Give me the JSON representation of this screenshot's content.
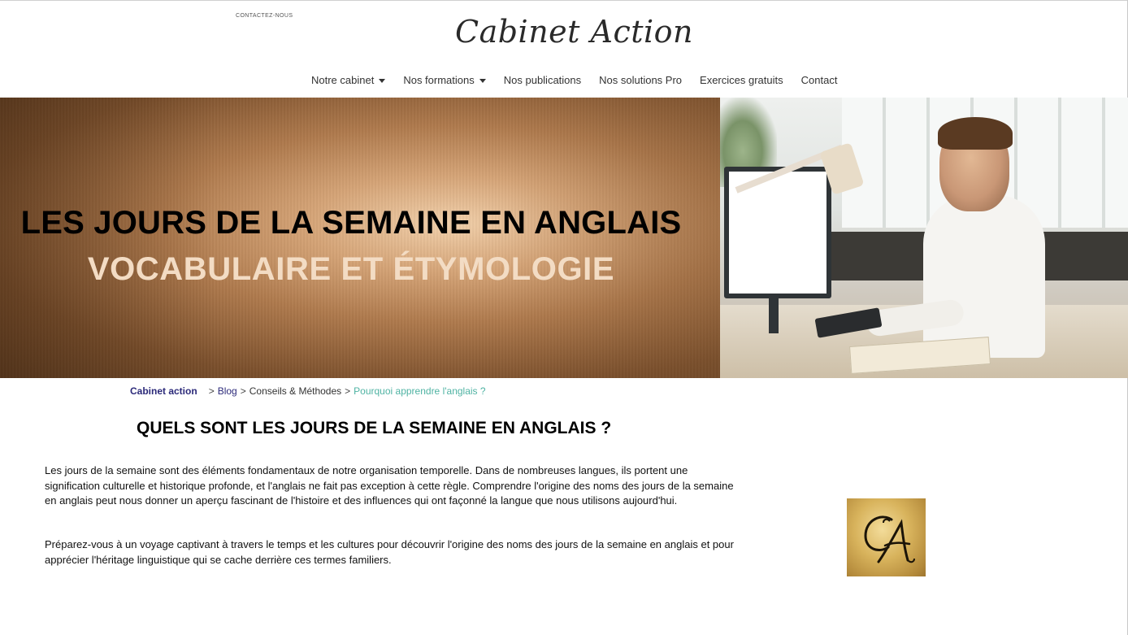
{
  "header": {
    "contact_link": "CONTACTEZ-NOUS",
    "logo_text": "Cabinet Action"
  },
  "nav": {
    "items": [
      {
        "label": "Notre cabinet",
        "has_dropdown": true
      },
      {
        "label": "Nos formations",
        "has_dropdown": true
      },
      {
        "label": "Nos publications",
        "has_dropdown": false
      },
      {
        "label": "Nos solutions Pro",
        "has_dropdown": false
      },
      {
        "label": "Exercices gratuits",
        "has_dropdown": false
      },
      {
        "label": "Contact",
        "has_dropdown": false
      }
    ]
  },
  "hero": {
    "title": "LES JOURS DE LA SEMAINE EN ANGLAIS",
    "subtitle": "VOCABULAIRE ET ÉTYMOLOGIE"
  },
  "breadcrumb": {
    "home": "Cabinet action",
    "items": [
      "Blog",
      "Conseils & Méthodes"
    ],
    "current": "Pourquoi apprendre l'anglais ?"
  },
  "article": {
    "title": "QUELS SONT LES JOURS DE LA SEMAINE EN ANGLAIS ?",
    "paragraphs": [
      "Les jours de la semaine sont des éléments fondamentaux de notre organisation temporelle. Dans de nombreuses langues, ils portent une signification culturelle et historique profonde, et l'anglais ne fait pas exception à cette règle. Comprendre l'origine des noms des jours de la semaine en anglais peut nous donner un aperçu fascinant de l'histoire et des influences qui ont façonné la langue que nous utilisons aujourd'hui.",
      "Préparez-vous à un voyage captivant à travers le temps et les cultures pour découvrir l'origine des noms des jours de la semaine en anglais et pour apprécier l'héritage linguistique qui se cache derrière ces termes familiers."
    ]
  },
  "seal": {
    "monogram": "CA"
  },
  "colors": {
    "breadcrumb_home": "#2c2a7a",
    "breadcrumb_current": "#4fb3a3",
    "hero_subtitle": "#f3dcc4",
    "seal_gold": "#d8b35c"
  }
}
